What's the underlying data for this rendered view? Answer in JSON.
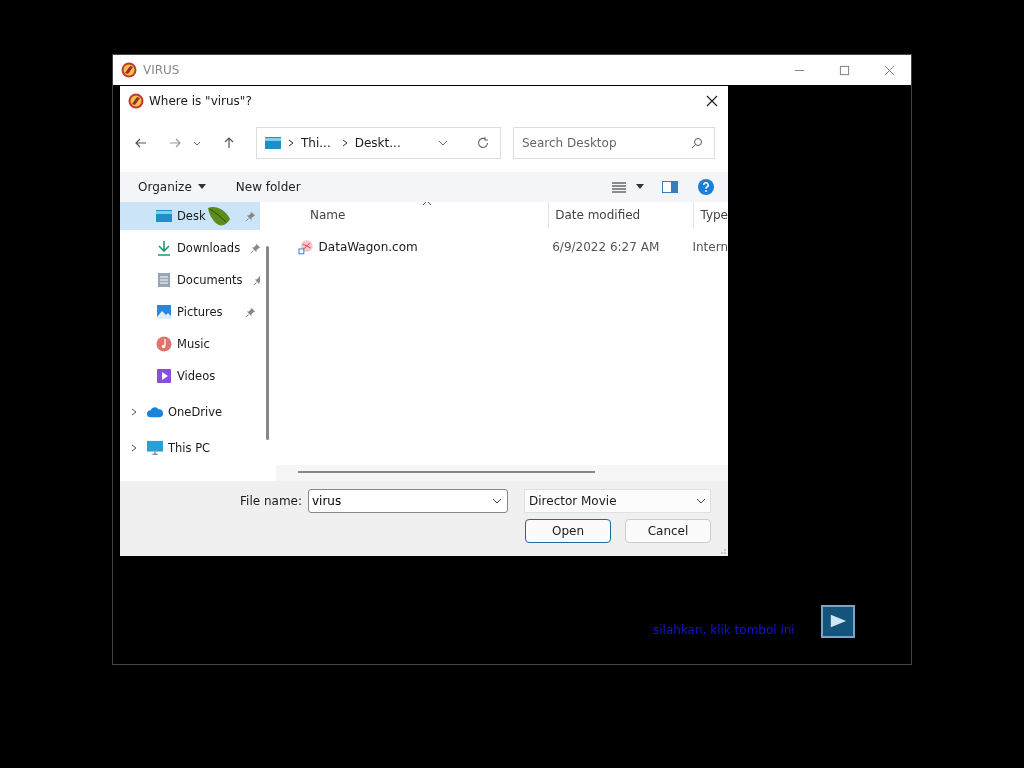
{
  "app_window": {
    "title": "VIRUS"
  },
  "dialog": {
    "title": "Where is \"virus\"?",
    "breadcrumb": [
      "Thi...",
      "Deskt..."
    ],
    "search": {
      "placeholder": "Search Desktop"
    },
    "toolbar": [
      "Organize",
      "New folder"
    ],
    "sidebar": {
      "items": [
        {
          "label": "Desk",
          "kind": "desktop",
          "pinned": true,
          "expandable": false,
          "selected": true
        },
        {
          "label": "Downloads",
          "kind": "downloads",
          "pinned": true,
          "expandable": false,
          "selected": false
        },
        {
          "label": "Documents",
          "kind": "documents",
          "pinned": true,
          "expandable": false,
          "selected": false
        },
        {
          "label": "Pictures",
          "kind": "pictures",
          "pinned": true,
          "expandable": false,
          "selected": false
        },
        {
          "label": "Music",
          "kind": "music",
          "pinned": false,
          "expandable": false,
          "selected": false
        },
        {
          "label": "Videos",
          "kind": "videos",
          "pinned": false,
          "expandable": false,
          "selected": false
        },
        {
          "label": "OneDrive",
          "kind": "cloud",
          "pinned": false,
          "expandable": true,
          "selected": false
        },
        {
          "label": "This PC",
          "kind": "pc",
          "pinned": false,
          "expandable": true,
          "selected": false
        }
      ]
    },
    "columns": [
      "Name",
      "Date modified",
      "Type"
    ],
    "files": [
      {
        "name": "DataWagon.com",
        "date": "6/9/2022 6:27 AM",
        "type": "Intern"
      }
    ],
    "file_name": {
      "label": "File name:",
      "value": "virus"
    },
    "file_type": "Director Movie",
    "buttons": [
      {
        "label": "Open",
        "default": true
      },
      {
        "label": "Cancel",
        "default": false
      }
    ]
  },
  "hint": "silahkan, klik tombol ini"
}
